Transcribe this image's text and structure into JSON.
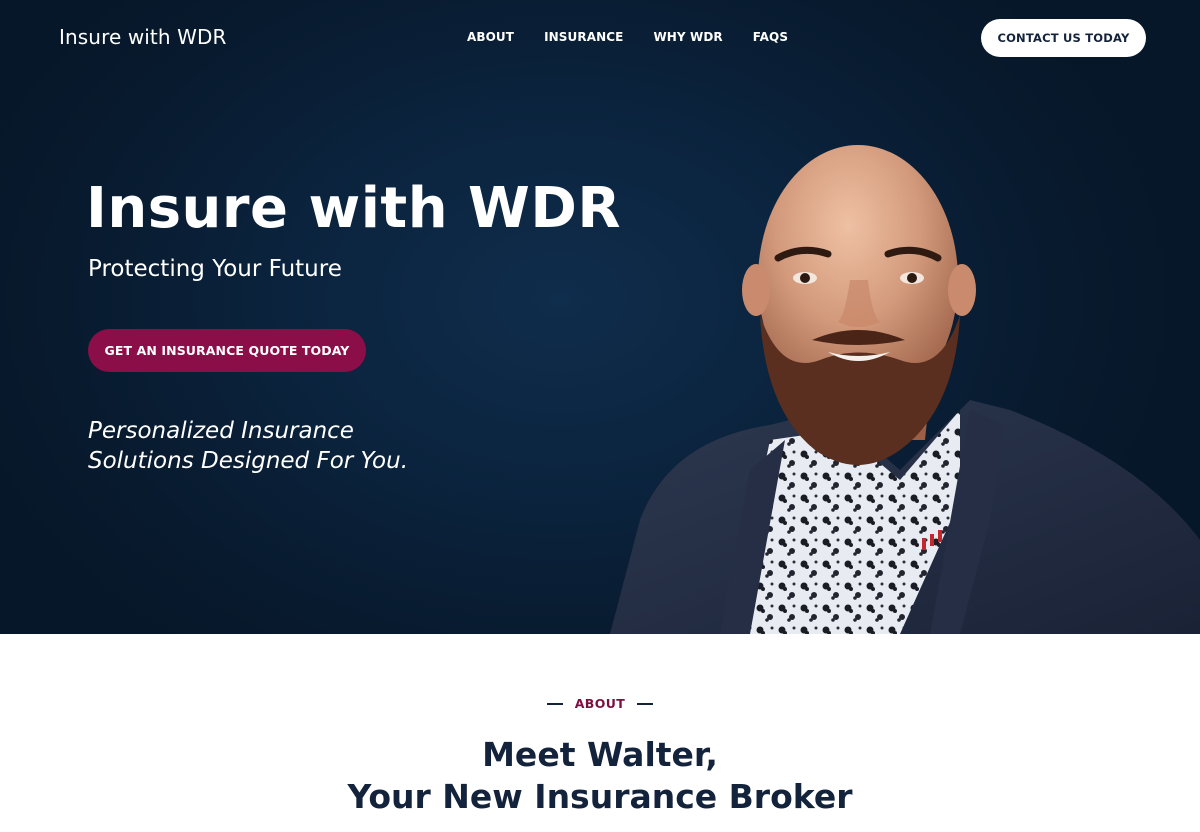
{
  "nav": {
    "logo": "Insure with WDR",
    "links": [
      "ABOUT",
      "INSURANCE",
      "WHY WDR",
      "FAQS"
    ],
    "cta": "CONTACT US TODAY"
  },
  "hero": {
    "title": "Insure with WDR",
    "subtitle": "Protecting Your Future",
    "button": "GET AN INSURANCE QUOTE TODAY",
    "tagline_line1": "Personalized Insurance",
    "tagline_line2": "Solutions Designed For You.",
    "image": "portrait-photo"
  },
  "about": {
    "eyebrow": "ABOUT",
    "title_line1": "Meet Walter,",
    "title_line2": "Your New Insurance Broker"
  },
  "colors": {
    "hero_bg": "#0b233d",
    "accent": "#8b0e48",
    "eyebrow": "#7b0f3f",
    "heading": "#13233b",
    "white": "#ffffff"
  }
}
